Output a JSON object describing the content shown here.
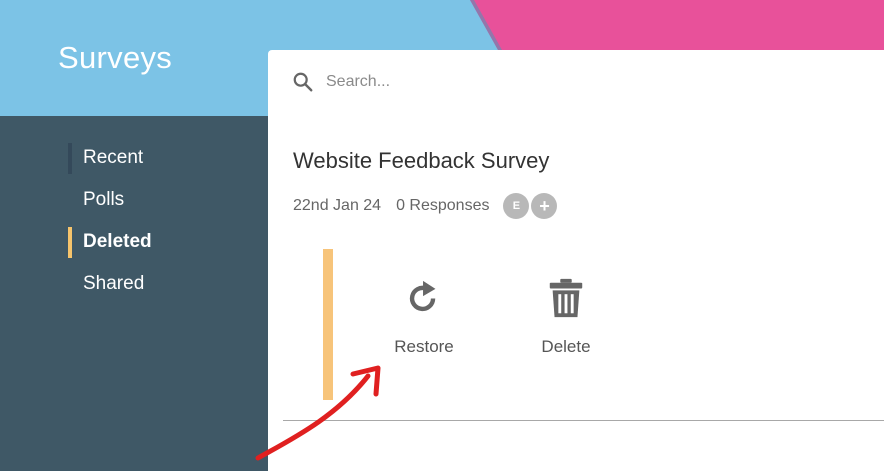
{
  "app": {
    "title": "Surveys"
  },
  "sidebar": {
    "items": [
      {
        "label": "Recent",
        "active": false
      },
      {
        "label": "Polls",
        "active": false
      },
      {
        "label": "Deleted",
        "active": true
      },
      {
        "label": "Shared",
        "active": false
      }
    ]
  },
  "search": {
    "placeholder": "Search...",
    "value": ""
  },
  "survey": {
    "title": "Website Feedback Survey",
    "date": "22nd Jan 24",
    "responses": "0 Responses",
    "avatars": [
      "E",
      "+"
    ]
  },
  "actions": {
    "restore_label": "Restore",
    "delete_label": "Delete"
  },
  "colors": {
    "sky": "#7cc3e6",
    "pink": "#e8519a",
    "sidebar": "#3f5866",
    "active_indicator": "#f6c46c",
    "accent_bar": "#f7c47a",
    "arrow": "#e02020"
  },
  "icons": [
    "search-icon",
    "restore-icon",
    "trash-icon",
    "annotation-arrow"
  ]
}
